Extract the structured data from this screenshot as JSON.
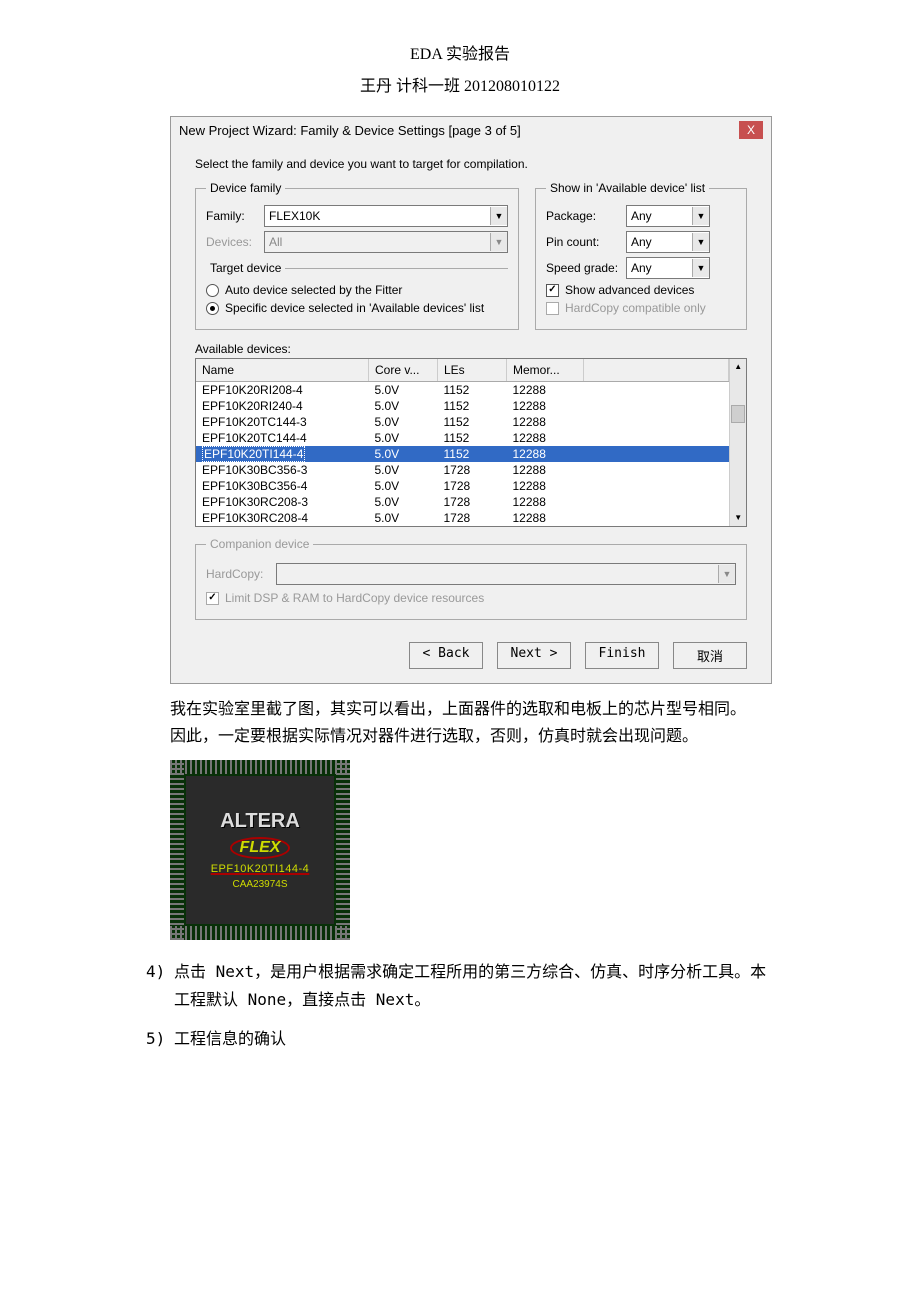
{
  "header": "EDA 实验报告",
  "subheader": "王丹 计科一班 201208010122",
  "dialog": {
    "title": "New Project Wizard: Family & Device Settings [page 3 of 5]",
    "instruction": "Select the family and device you want to target for compilation.",
    "device_family_legend": "Device family",
    "family_label": "Family:",
    "family_value": "FLEX10K",
    "devices_label": "Devices:",
    "devices_value": "All",
    "show_in_legend": "Show in 'Available device' list",
    "package_label": "Package:",
    "package_value": "Any",
    "pincount_label": "Pin count:",
    "pincount_value": "Any",
    "speed_label": "Speed grade:",
    "speed_value": "Any",
    "show_adv_label": "Show advanced devices",
    "hardcopy_only_label": "HardCopy compatible only",
    "target_legend": "Target device",
    "radio_auto": "Auto device selected by the Fitter",
    "radio_specific": "Specific device selected in 'Available devices' list",
    "available_label": "Available devices:",
    "cols": {
      "name": "Name",
      "core": "Core v...",
      "les": "LEs",
      "mem": "Memor..."
    },
    "rows": [
      {
        "name": "EPF10K20RI208-4",
        "core": "5.0V",
        "les": "1152",
        "mem": "12288",
        "sel": false
      },
      {
        "name": "EPF10K20RI240-4",
        "core": "5.0V",
        "les": "1152",
        "mem": "12288",
        "sel": false
      },
      {
        "name": "EPF10K20TC144-3",
        "core": "5.0V",
        "les": "1152",
        "mem": "12288",
        "sel": false
      },
      {
        "name": "EPF10K20TC144-4",
        "core": "5.0V",
        "les": "1152",
        "mem": "12288",
        "sel": false
      },
      {
        "name": "EPF10K20TI144-4",
        "core": "5.0V",
        "les": "1152",
        "mem": "12288",
        "sel": true
      },
      {
        "name": "EPF10K30BC356-3",
        "core": "5.0V",
        "les": "1728",
        "mem": "12288",
        "sel": false
      },
      {
        "name": "EPF10K30BC356-4",
        "core": "5.0V",
        "les": "1728",
        "mem": "12288",
        "sel": false
      },
      {
        "name": "EPF10K30RC208-3",
        "core": "5.0V",
        "les": "1728",
        "mem": "12288",
        "sel": false
      },
      {
        "name": "EPF10K30RC208-4",
        "core": "5.0V",
        "les": "1728",
        "mem": "12288",
        "sel": false
      }
    ],
    "companion_legend": "Companion device",
    "hardcopy_label": "HardCopy:",
    "limit_dsp_label": "Limit DSP & RAM to HardCopy device resources",
    "buttons": {
      "back": "< Back",
      "next": "Next >",
      "finish": "Finish",
      "cancel": "取消"
    }
  },
  "para1": "我在实验室里截了图，其实可以看出，上面器件的选取和电板上的芯片型号相同。因此，一定要根据实际情况对器件进行选取，否则，仿真时就会出现问题。",
  "chip": {
    "brand": "ALTERA",
    "flex": "FLEX",
    "part": "EPF10K20TI144-4",
    "code": "CAA23974S"
  },
  "steps": {
    "s4_num": "4)",
    "s4": "点击 Next，是用户根据需求确定工程所用的第三方综合、仿真、时序分析工具。本工程默认 None，直接点击 Next。",
    "s5_num": "5)",
    "s5": "工程信息的确认"
  }
}
